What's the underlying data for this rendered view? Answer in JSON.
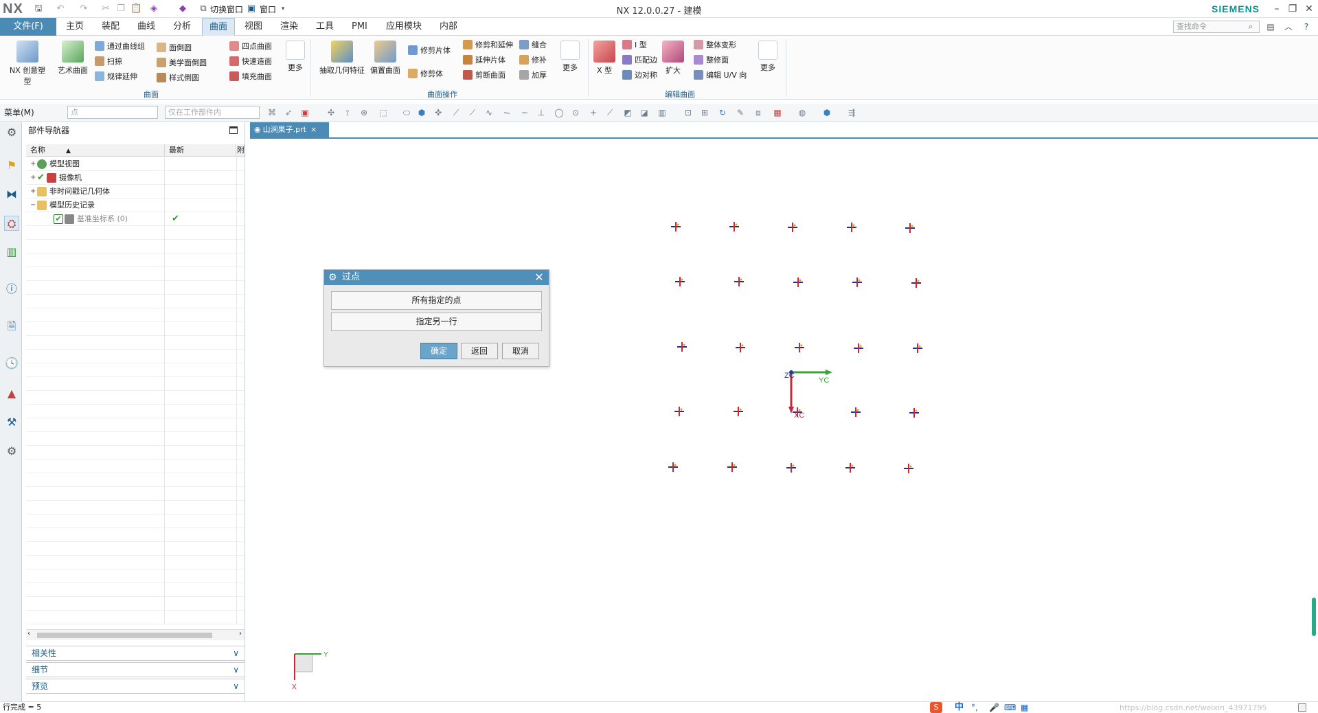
{
  "app": {
    "logo": "NX",
    "window_title": "NX 12.0.0.27 - 建模",
    "brand": "SIEMENS",
    "quick_access": {
      "switch_window": "切换窗口",
      "window_menu": "窗口"
    }
  },
  "menu": {
    "file_label": "文件(F)",
    "tabs": [
      "主页",
      "装配",
      "曲线",
      "分析",
      "曲面",
      "视图",
      "渲染",
      "工具",
      "PMI",
      "应用模块",
      "内部"
    ],
    "active_tab": "曲面",
    "search_placeholder": "查找命令"
  },
  "ribbon": {
    "groups": {
      "surface": "曲面",
      "surface_ops": "曲面操作",
      "edit_surface": "编辑曲面"
    },
    "big_buttons": {
      "nx_creative": "NX 创意塑型",
      "studio_surface": "艺术曲面",
      "extract_geometry": "抽取几何特征",
      "offset_surface": "偏置曲面",
      "x_type": "X 型",
      "enlarge": "扩大",
      "more1": "更多",
      "more2": "更多",
      "more3": "更多"
    },
    "small_buttons": {
      "through_curve_mesh": "通过曲线组",
      "sweep": "扫掠",
      "law_extension": "规律延伸",
      "face_blend": "面倒圆",
      "aesthetic_face_blend": "美学面倒圆",
      "styled_blend": "样式倒圆",
      "four_point_surface": "四点曲面",
      "quick_surface": "快速造面",
      "fill_surface": "填充曲面",
      "trim_sheet": "修剪片体",
      "trim_body": "修剪体",
      "trim_extend": "修剪和延伸",
      "extend_sheet": "延伸片体",
      "trim_face": "剪断曲面",
      "sew": "缝合",
      "patch": "修补",
      "thicken": "加厚",
      "i_type": "I 型",
      "match_edge": "匹配边",
      "edge_symmetry": "边对称",
      "global_shaping": "整体变形",
      "refit_face": "整修面",
      "edit_uv": "编辑 U/V 向"
    }
  },
  "cmdbar": {
    "menu_label": "菜单(M)",
    "filter_value": "点",
    "scope_value": "仅在工作部件内"
  },
  "navigator": {
    "title": "部件导航器",
    "columns": [
      "名称",
      "最新",
      "附"
    ],
    "rows": [
      {
        "label": "模型视图",
        "indent": 0
      },
      {
        "label": "摄像机",
        "indent": 0
      },
      {
        "label": "非时间戳记几何体",
        "indent": 0
      },
      {
        "label": "模型历史记录",
        "indent": 0
      },
      {
        "label": "基准坐标系 (0)",
        "indent": 1,
        "latest": "✔"
      }
    ],
    "sections": [
      "相关性",
      "细节",
      "预览"
    ]
  },
  "document": {
    "tab_label": "山涧果子.prt"
  },
  "graphics": {
    "wcs_labels": {
      "zc": "ZC",
      "yc": "YC",
      "xc": "XC"
    },
    "triad_labels": {
      "y": "Y",
      "x": "X"
    }
  },
  "dialog": {
    "title": "过点",
    "btn_all_points": "所有指定的点",
    "btn_another_row": "指定另一行",
    "ok": "确定",
    "back": "返回",
    "cancel": "取消"
  },
  "status": {
    "message": "行完成 = 5",
    "ime": "中",
    "watermark": "https://blog.csdn.net/weixin_43971795"
  },
  "colors": {
    "accent": "#4a8ab4",
    "dialog_title": "#4f8fb8",
    "point_red": "#cc2a2a",
    "point_blue": "#2a2a9a"
  }
}
